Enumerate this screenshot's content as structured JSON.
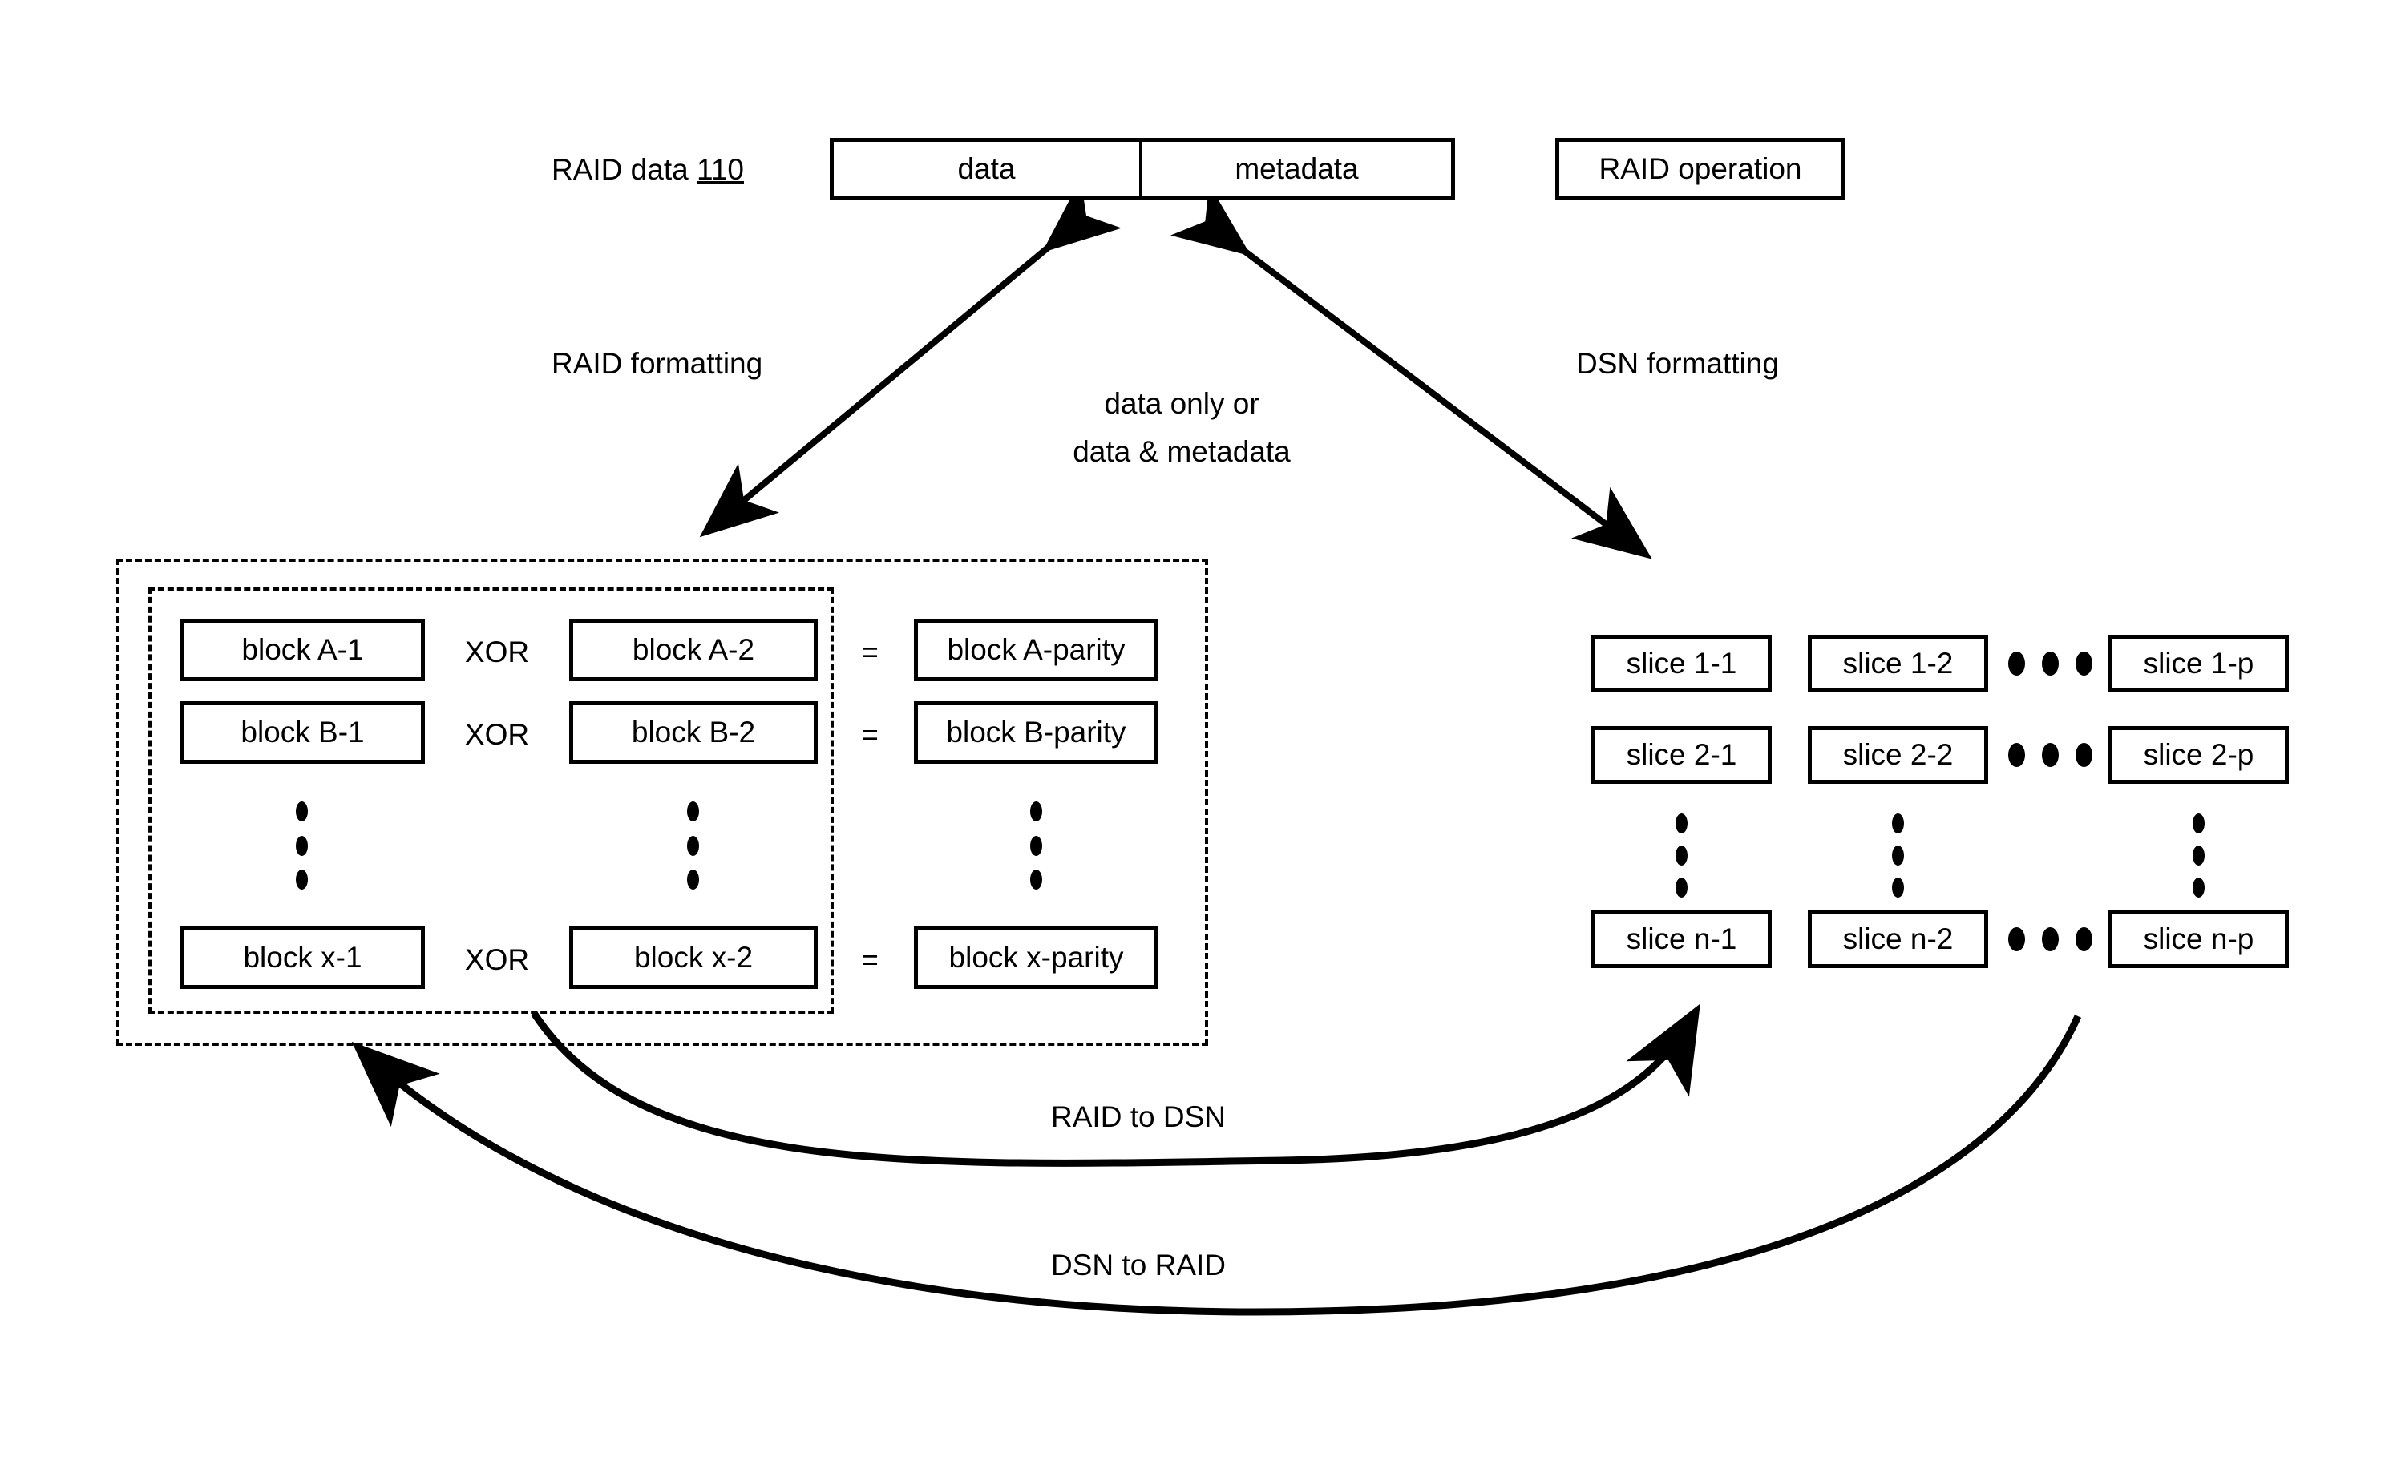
{
  "diagram": {
    "top_row": {
      "raid_data_label": "RAID data ",
      "raid_data_ref": "110",
      "data_cell": "data",
      "metadata_cell": "metadata",
      "raid_operation": "RAID operation"
    },
    "transform_labels": {
      "raid_formatting": "RAID formatting",
      "dsn_formatting": "DSN formatting",
      "payload_line1": "data only or",
      "payload_line2": "data & metadata"
    },
    "raid_group": {
      "operator": "XOR",
      "equals": "=",
      "rows": [
        {
          "operand1": "block A-1",
          "operand2": "block A-2",
          "parity": "block A-parity"
        },
        {
          "operand1": "block B-1",
          "operand2": "block B-2",
          "parity": "block B-parity"
        },
        {
          "operand1": "block x-1",
          "operand2": "block x-2",
          "parity": "block x-parity"
        }
      ]
    },
    "dsn_group": {
      "rows": [
        {
          "col1": "slice 1-1",
          "col2": "slice 1-2",
          "colp": "slice 1-p"
        },
        {
          "col1": "slice 2-1",
          "col2": "slice 2-2",
          "colp": "slice 2-p"
        },
        {
          "col1": "slice n-1",
          "col2": "slice n-2",
          "colp": "slice n-p"
        }
      ]
    },
    "conversion_labels": {
      "raid_to_dsn": "RAID to DSN",
      "dsn_to_raid": "DSN to RAID"
    },
    "colors": {
      "stroke": "#000000",
      "background": "#ffffff"
    }
  }
}
